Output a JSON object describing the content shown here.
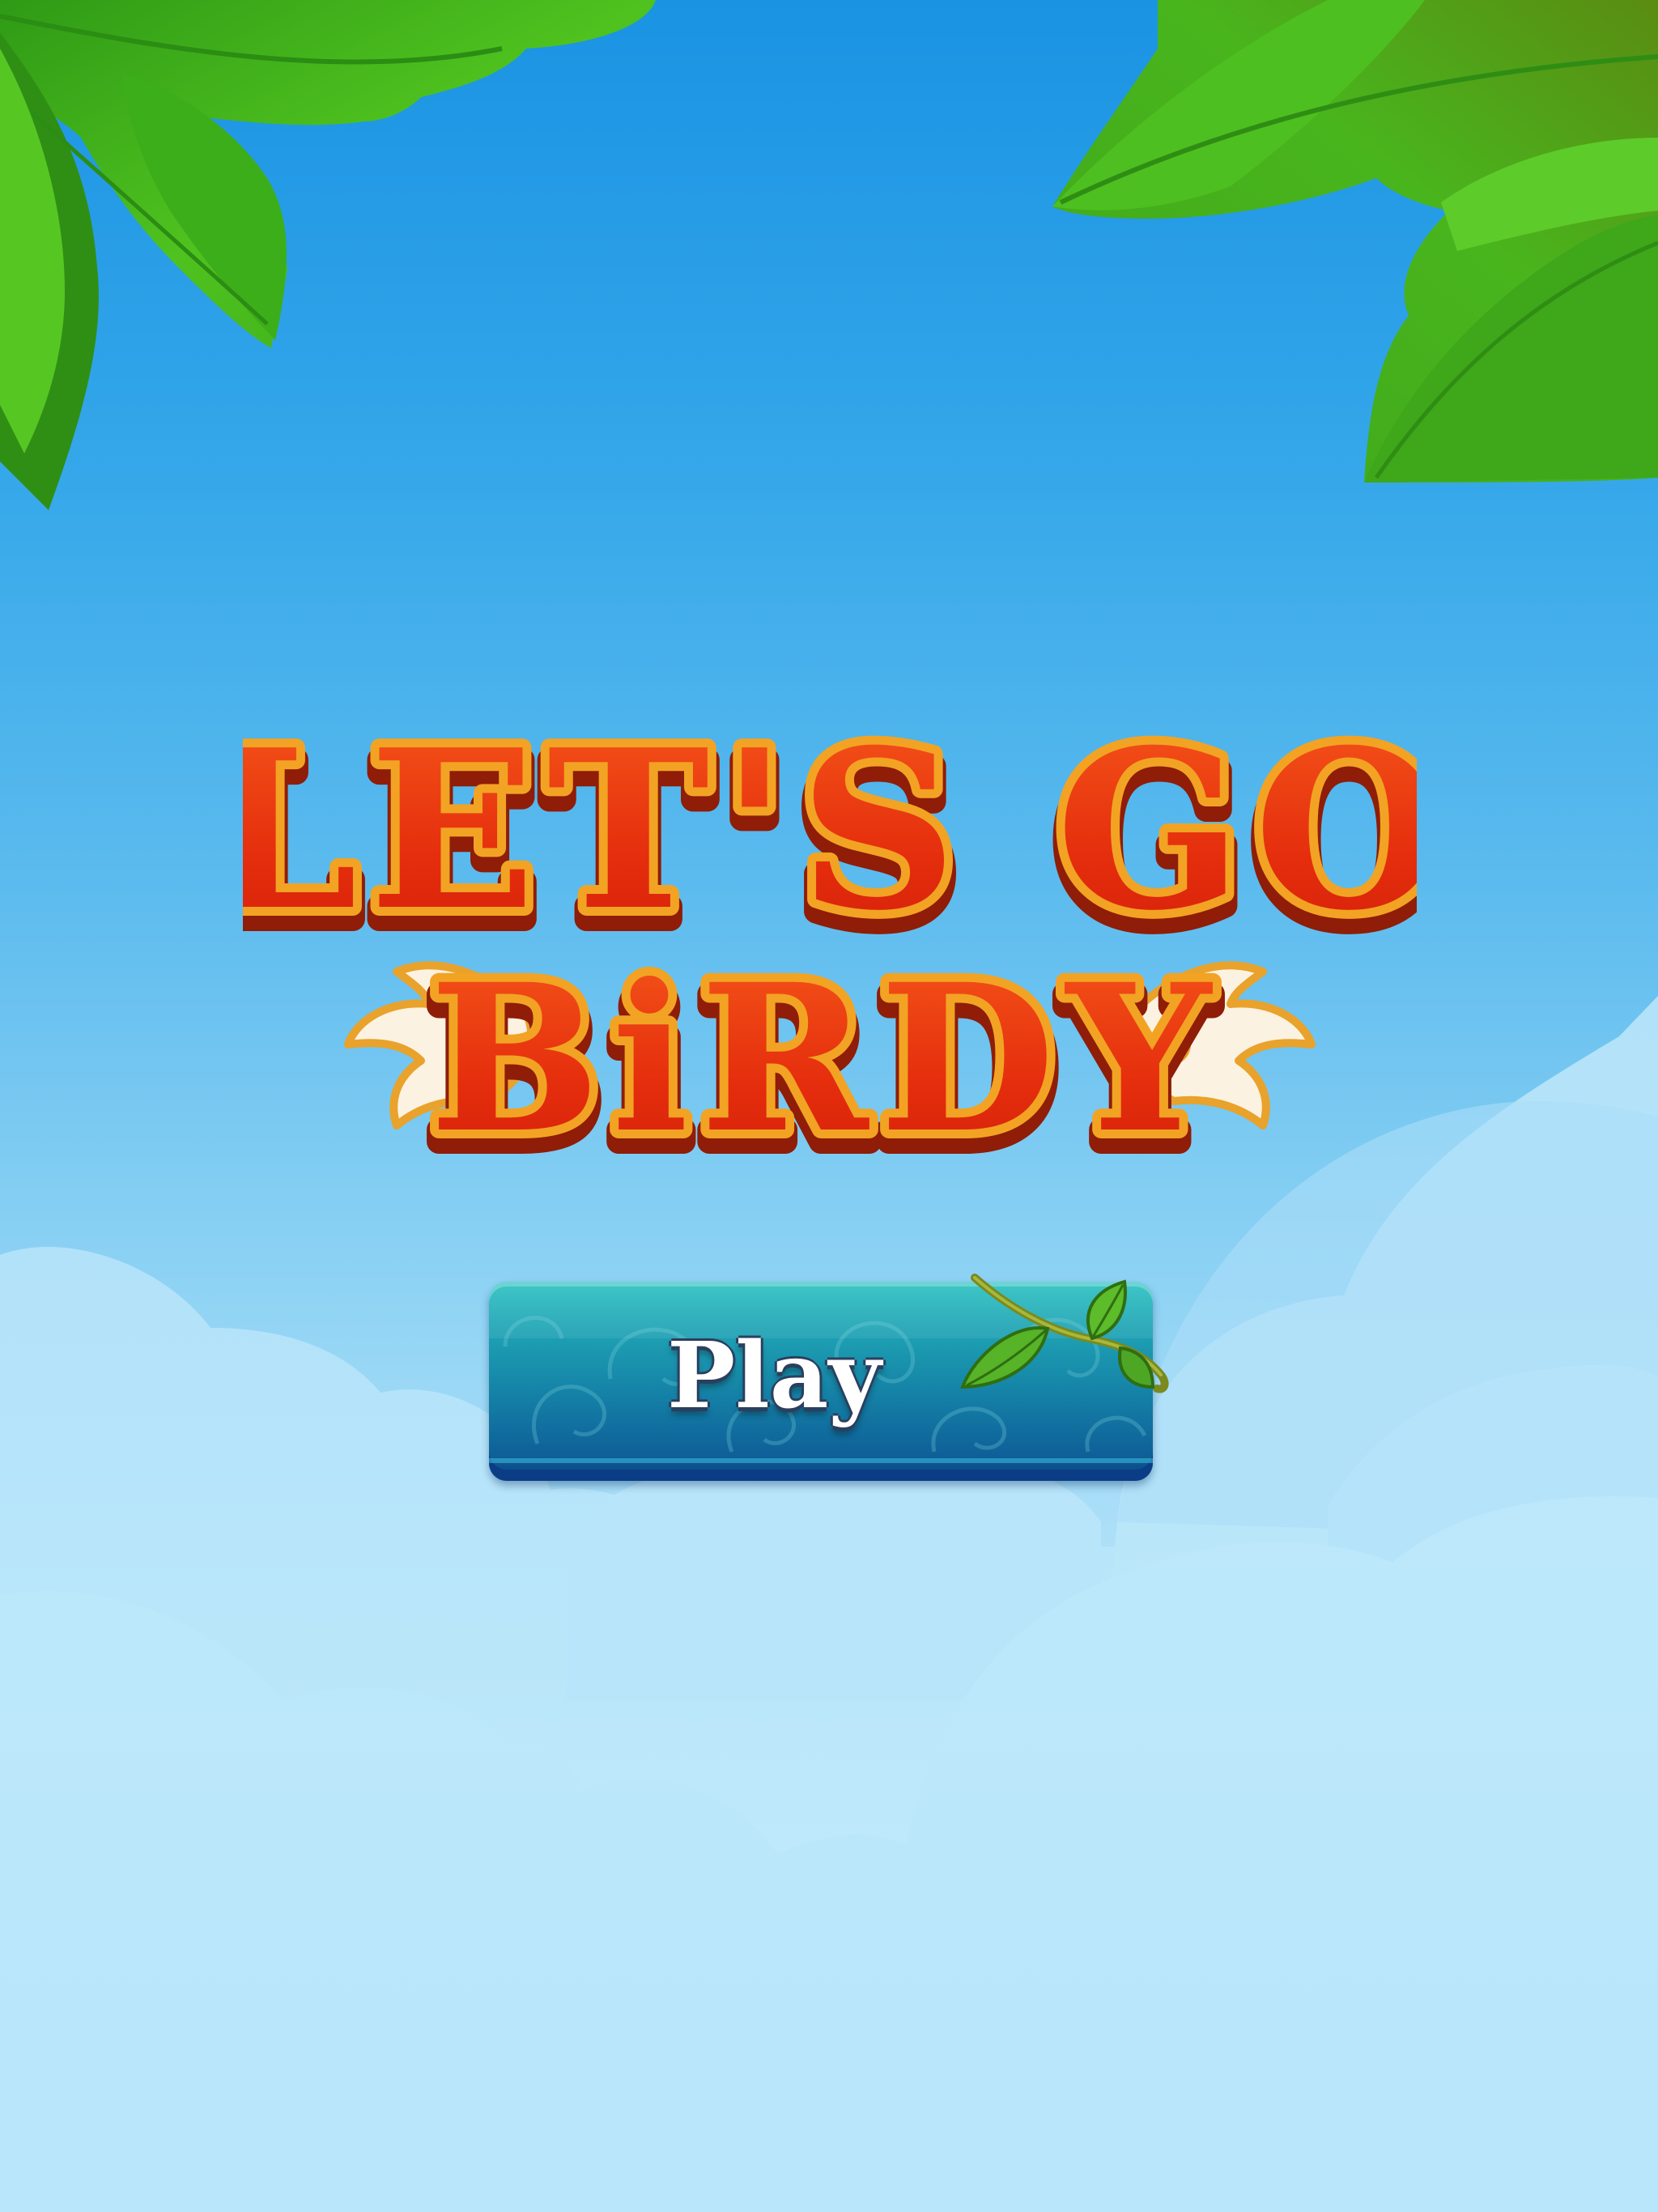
{
  "game": {
    "title_line1": "LET'S GO",
    "title_line2": "BiRDY",
    "play_label": "Play"
  },
  "colors": {
    "sky_top": "#1a93e3",
    "sky_bottom": "#bfe9fc",
    "title_fill": "#e8300f",
    "title_outline": "#f2a323",
    "title_shadow": "#8f1d08",
    "wing": "#fbf2e1",
    "button_top": "#2dc3c2",
    "button_bottom": "#0a3f7f",
    "leaf_green": "#43b51b"
  },
  "icons": [
    "leaf-icon",
    "wing-icon",
    "vine-icon",
    "cloud-icon"
  ]
}
